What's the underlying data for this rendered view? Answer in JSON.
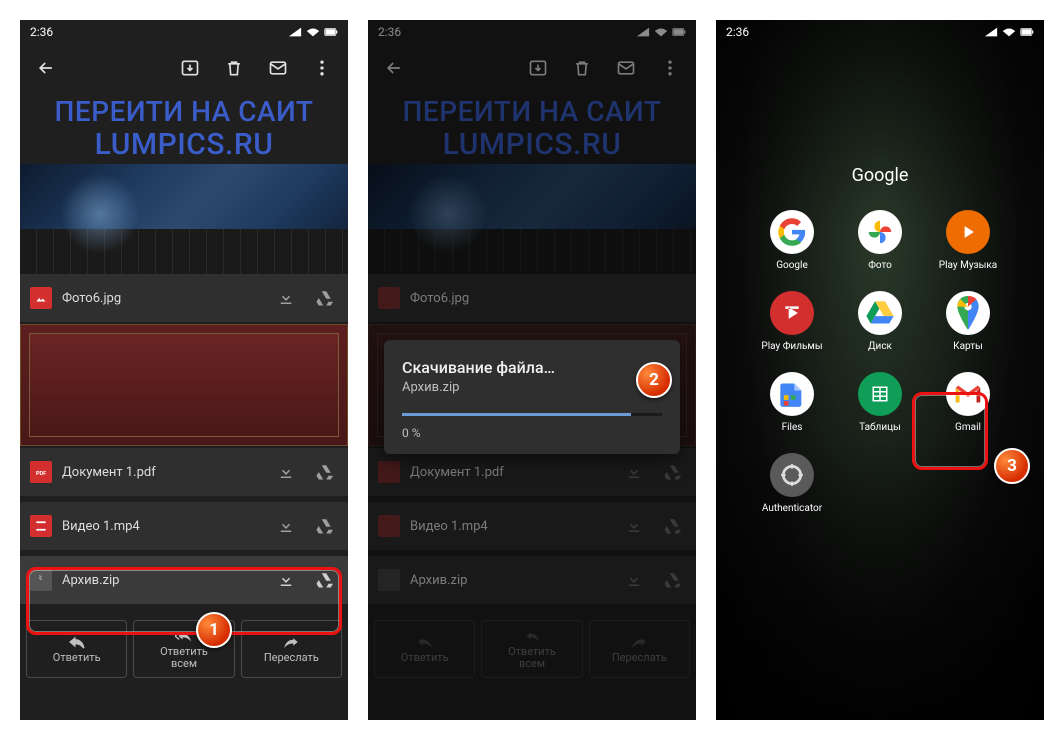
{
  "status": {
    "time": "2:36"
  },
  "header": {
    "line1": "ПЕРЕИТИ НА САИТ",
    "line2": "LUMPICS.RU"
  },
  "files": {
    "photo": "Фото6.jpg",
    "doc": "Документ 1.pdf",
    "video": "Видео 1.mp4",
    "archive": "Архив.zip"
  },
  "reply": {
    "reply": "Ответить",
    "reply_all": "Ответить\nвсем",
    "reply_all_l1": "Ответить",
    "reply_all_l2": "всем",
    "forward": "Переслать"
  },
  "dialog": {
    "title": "Скачивание файла…",
    "file": "Архив.zip",
    "pct": "0 %"
  },
  "home": {
    "folder": "Google",
    "apps": {
      "google": "Google",
      "photos": "Фото",
      "playmusic": "Play Музыка",
      "playfilms": "Play Фильмы",
      "drive": "Диск",
      "maps": "Карты",
      "files": "Files",
      "sheets": "Таблицы",
      "gmail": "Gmail",
      "auth": "Authenticator"
    }
  },
  "badges": {
    "n1": "1",
    "n2": "2",
    "n3": "3"
  }
}
